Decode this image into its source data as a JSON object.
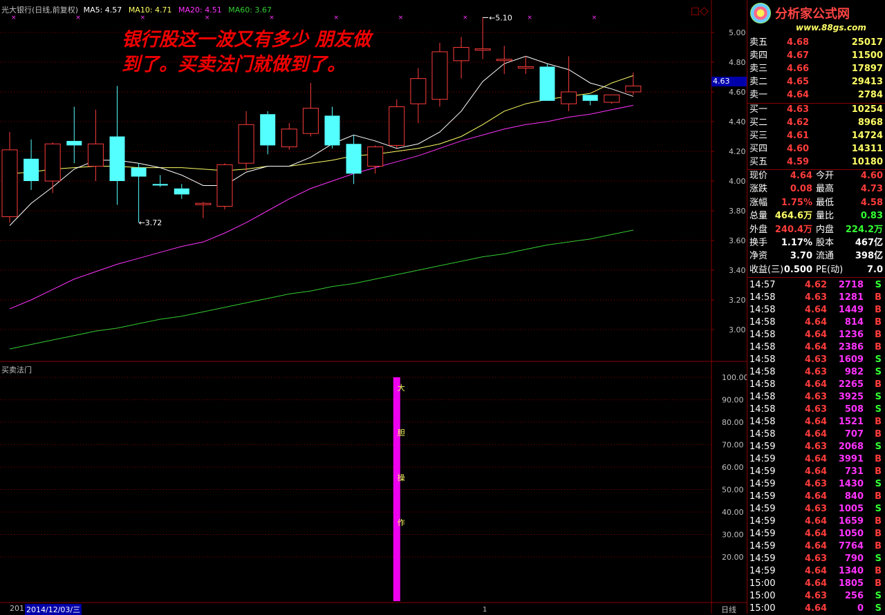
{
  "header": {
    "title": "光大银行(日线,前复权)",
    "ma5_label": "MA5: 4.57",
    "ma10_label": "MA10: 4.71",
    "ma20_label": "MA20: 4.51",
    "ma60_label": "MA60: 3.67"
  },
  "colors": {
    "up": "#ff3c3c",
    "down": "#54ffff",
    "ma5": "#ffffff",
    "ma10": "#ffff66",
    "ma20": "#ff33ff",
    "ma60": "#33cc33",
    "grid": "#8a0000",
    "axis": "#c0c0c0"
  },
  "annotation": {
    "line1": "银行股这一波又有多少 朋友做",
    "line2": "到了。买卖法门就做到了。"
  },
  "price_axis": [
    "5.00",
    "4.80",
    "4.60",
    "4.40",
    "4.20",
    "4.00",
    "3.80",
    "3.60",
    "3.40",
    "3.20",
    "3.00"
  ],
  "current_price_tag": "4.63",
  "high_marker": "5.10",
  "low_marker": "3.72",
  "indicator": {
    "title": "买卖法门",
    "axis": [
      "100.00",
      "90.00",
      "80.00",
      "70.00",
      "60.00",
      "50.00",
      "40.00",
      "30.00",
      "20.00"
    ],
    "bar_chars": [
      "大",
      "胆",
      "操",
      "作"
    ]
  },
  "chart_data": {
    "type": "candlestick",
    "candles": [
      {
        "o": 3.76,
        "h": 4.33,
        "l": 3.72,
        "c": 4.21
      },
      {
        "o": 4.15,
        "h": 4.28,
        "l": 3.94,
        "c": 4.0
      },
      {
        "o": 4.0,
        "h": 4.26,
        "l": 3.92,
        "c": 4.25
      },
      {
        "o": 4.27,
        "h": 4.5,
        "l": 4.12,
        "c": 4.24
      },
      {
        "o": 4.1,
        "h": 4.48,
        "l": 4.0,
        "c": 4.25
      },
      {
        "o": 4.3,
        "h": 4.64,
        "l": 3.84,
        "c": 4.0
      },
      {
        "o": 4.09,
        "h": 4.12,
        "l": 3.72,
        "c": 4.03
      },
      {
        "o": 3.98,
        "h": 4.04,
        "l": 3.96,
        "c": 3.97
      },
      {
        "o": 3.95,
        "h": 3.98,
        "l": 3.88,
        "c": 3.91
      },
      {
        "o": 3.85,
        "h": 3.86,
        "l": 3.75,
        "c": 3.85
      },
      {
        "o": 3.83,
        "h": 4.12,
        "l": 3.81,
        "c": 4.11
      },
      {
        "o": 4.12,
        "h": 4.47,
        "l": 4.07,
        "c": 4.38
      },
      {
        "o": 4.45,
        "h": 4.47,
        "l": 4.18,
        "c": 4.24
      },
      {
        "o": 4.23,
        "h": 4.39,
        "l": 4.21,
        "c": 4.35
      },
      {
        "o": 4.32,
        "h": 4.66,
        "l": 4.3,
        "c": 4.49
      },
      {
        "o": 4.44,
        "h": 4.5,
        "l": 4.22,
        "c": 4.24
      },
      {
        "o": 4.25,
        "h": 4.31,
        "l": 3.98,
        "c": 4.05
      },
      {
        "o": 4.1,
        "h": 4.24,
        "l": 4.05,
        "c": 4.23
      },
      {
        "o": 4.24,
        "h": 4.55,
        "l": 4.22,
        "c": 4.5
      },
      {
        "o": 4.52,
        "h": 4.76,
        "l": 4.39,
        "c": 4.69
      },
      {
        "o": 4.55,
        "h": 4.93,
        "l": 4.5,
        "c": 4.87
      },
      {
        "o": 4.81,
        "h": 4.97,
        "l": 4.69,
        "c": 4.9
      },
      {
        "o": 4.89,
        "h": 5.1,
        "l": 4.82,
        "c": 4.89
      },
      {
        "o": 4.82,
        "h": 4.91,
        "l": 4.72,
        "c": 4.82
      },
      {
        "o": 4.76,
        "h": 4.84,
        "l": 4.72,
        "c": 4.77
      },
      {
        "o": 4.77,
        "h": 4.79,
        "l": 4.55,
        "c": 4.54
      },
      {
        "o": 4.52,
        "h": 4.84,
        "l": 4.47,
        "c": 4.6
      },
      {
        "o": 4.58,
        "h": 4.58,
        "l": 4.51,
        "c": 4.54
      },
      {
        "o": 4.53,
        "h": 4.58,
        "l": 4.52,
        "c": 4.58
      },
      {
        "o": 4.6,
        "h": 4.73,
        "l": 4.58,
        "c": 4.64
      }
    ],
    "ma5": [
      3.7,
      3.85,
      3.96,
      4.08,
      4.14,
      4.14,
      4.12,
      4.09,
      4.04,
      3.97,
      3.97,
      4.06,
      4.1,
      4.1,
      4.16,
      4.25,
      4.31,
      4.27,
      4.22,
      4.25,
      4.33,
      4.47,
      4.67,
      4.79,
      4.84,
      4.79,
      4.75,
      4.66,
      4.62,
      4.57
    ],
    "ma10": [
      4.05,
      4.06,
      4.08,
      4.09,
      4.1,
      4.1,
      4.09,
      4.09,
      4.09,
      4.08,
      4.07,
      4.08,
      4.1,
      4.1,
      4.12,
      4.14,
      4.17,
      4.18,
      4.2,
      4.22,
      4.25,
      4.3,
      4.38,
      4.47,
      4.52,
      4.55,
      4.57,
      4.59,
      4.66,
      4.71
    ],
    "ma20": [
      3.14,
      3.2,
      3.27,
      3.34,
      3.39,
      3.44,
      3.48,
      3.52,
      3.56,
      3.59,
      3.65,
      3.72,
      3.8,
      3.88,
      3.95,
      4.0,
      4.05,
      4.09,
      4.13,
      4.17,
      4.22,
      4.27,
      4.31,
      4.35,
      4.38,
      4.4,
      4.43,
      4.45,
      4.48,
      4.51
    ],
    "ma60": [
      2.87,
      2.9,
      2.93,
      2.96,
      2.99,
      3.01,
      3.04,
      3.07,
      3.09,
      3.12,
      3.15,
      3.18,
      3.21,
      3.24,
      3.26,
      3.29,
      3.31,
      3.34,
      3.37,
      3.4,
      3.43,
      3.46,
      3.49,
      3.51,
      3.54,
      3.57,
      3.59,
      3.61,
      3.64,
      3.67
    ],
    "indicator_bar": {
      "index": 18,
      "value": 100
    },
    "ylim": [
      2.9,
      5.1
    ]
  },
  "panel": {
    "logo_text": "分析家公式网",
    "logo_url": "www.88gs.com",
    "asks": [
      {
        "label": "卖五",
        "price": "4.68",
        "vol": "25017"
      },
      {
        "label": "卖四",
        "price": "4.67",
        "vol": "11500"
      },
      {
        "label": "卖三",
        "price": "4.66",
        "vol": "17897"
      },
      {
        "label": "卖二",
        "price": "4.65",
        "vol": "29413"
      },
      {
        "label": "卖一",
        "price": "4.64",
        "vol": "2784"
      }
    ],
    "bids": [
      {
        "label": "买一",
        "price": "4.63",
        "vol": "10254"
      },
      {
        "label": "买二",
        "price": "4.62",
        "vol": "8968"
      },
      {
        "label": "买三",
        "price": "4.61",
        "vol": "14724"
      },
      {
        "label": "买四",
        "price": "4.60",
        "vol": "14311"
      },
      {
        "label": "买五",
        "price": "4.59",
        "vol": "10180"
      }
    ],
    "stats": [
      {
        "l1": "现价",
        "v1": "4.64",
        "l2": "今开",
        "v2": "4.60",
        "c1": "#ff3c3c",
        "c2": "#ff3c3c"
      },
      {
        "l1": "涨跌",
        "v1": "0.08",
        "l2": "最高",
        "v2": "4.73",
        "c1": "#ff3c3c",
        "c2": "#ff3c3c"
      },
      {
        "l1": "涨幅",
        "v1": "1.75%",
        "l2": "最低",
        "v2": "4.58",
        "c1": "#ff3c3c",
        "c2": "#ff3c3c"
      },
      {
        "l1": "总量",
        "v1": "464.6万",
        "l2": "量比",
        "v2": "0.83",
        "c1": "#ffff66",
        "c2": "#33ff33"
      },
      {
        "l1": "外盘",
        "v1": "240.4万",
        "l2": "内盘",
        "v2": "224.2万",
        "c1": "#ff3c3c",
        "c2": "#33ff33"
      },
      {
        "l1": "换手",
        "v1": "1.17%",
        "l2": "股本",
        "v2": "467亿",
        "c1": "#ffffff",
        "c2": "#ffffff"
      },
      {
        "l1": "净资",
        "v1": "3.70",
        "l2": "流通",
        "v2": "398亿",
        "c1": "#ffffff",
        "c2": "#ffffff"
      },
      {
        "l1": "收益(三)",
        "v1": "0.500",
        "l2": "PE(动)",
        "v2": "7.0",
        "c1": "#ffffff",
        "c2": "#ffffff"
      }
    ],
    "ticks": [
      {
        "t": "14:57",
        "p": "4.62",
        "v": "2718",
        "d": "S"
      },
      {
        "t": "14:58",
        "p": "4.63",
        "v": "1281",
        "d": "B"
      },
      {
        "t": "14:58",
        "p": "4.64",
        "v": "1449",
        "d": "B"
      },
      {
        "t": "14:58",
        "p": "4.64",
        "v": "814",
        "d": "B"
      },
      {
        "t": "14:58",
        "p": "4.64",
        "v": "1236",
        "d": "B"
      },
      {
        "t": "14:58",
        "p": "4.64",
        "v": "2386",
        "d": "B"
      },
      {
        "t": "14:58",
        "p": "4.63",
        "v": "1609",
        "d": "S"
      },
      {
        "t": "14:58",
        "p": "4.63",
        "v": "982",
        "d": "S"
      },
      {
        "t": "14:58",
        "p": "4.64",
        "v": "2265",
        "d": "B"
      },
      {
        "t": "14:58",
        "p": "4.63",
        "v": "3925",
        "d": "S"
      },
      {
        "t": "14:58",
        "p": "4.63",
        "v": "508",
        "d": "S"
      },
      {
        "t": "14:58",
        "p": "4.64",
        "v": "1521",
        "d": "B"
      },
      {
        "t": "14:58",
        "p": "4.64",
        "v": "707",
        "d": "B"
      },
      {
        "t": "14:59",
        "p": "4.63",
        "v": "2068",
        "d": "S"
      },
      {
        "t": "14:59",
        "p": "4.64",
        "v": "3991",
        "d": "B"
      },
      {
        "t": "14:59",
        "p": "4.64",
        "v": "731",
        "d": "B"
      },
      {
        "t": "14:59",
        "p": "4.63",
        "v": "1430",
        "d": "S"
      },
      {
        "t": "14:59",
        "p": "4.64",
        "v": "840",
        "d": "B"
      },
      {
        "t": "14:59",
        "p": "4.63",
        "v": "1005",
        "d": "S"
      },
      {
        "t": "14:59",
        "p": "4.64",
        "v": "1659",
        "d": "B"
      },
      {
        "t": "14:59",
        "p": "4.64",
        "v": "1050",
        "d": "B"
      },
      {
        "t": "14:59",
        "p": "4.64",
        "v": "7764",
        "d": "B"
      },
      {
        "t": "14:59",
        "p": "4.63",
        "v": "790",
        "d": "S"
      },
      {
        "t": "14:59",
        "p": "4.64",
        "v": "1340",
        "d": "B"
      },
      {
        "t": "15:00",
        "p": "4.64",
        "v": "1805",
        "d": "B"
      },
      {
        "t": "15:00",
        "p": "4.63",
        "v": "256",
        "d": "S"
      },
      {
        "t": "15:00",
        "p": "4.64",
        "v": "0",
        "d": "S"
      }
    ]
  },
  "footer": {
    "year_label": "201",
    "date_label": "2014/12/03/三",
    "period_label": "日线"
  }
}
